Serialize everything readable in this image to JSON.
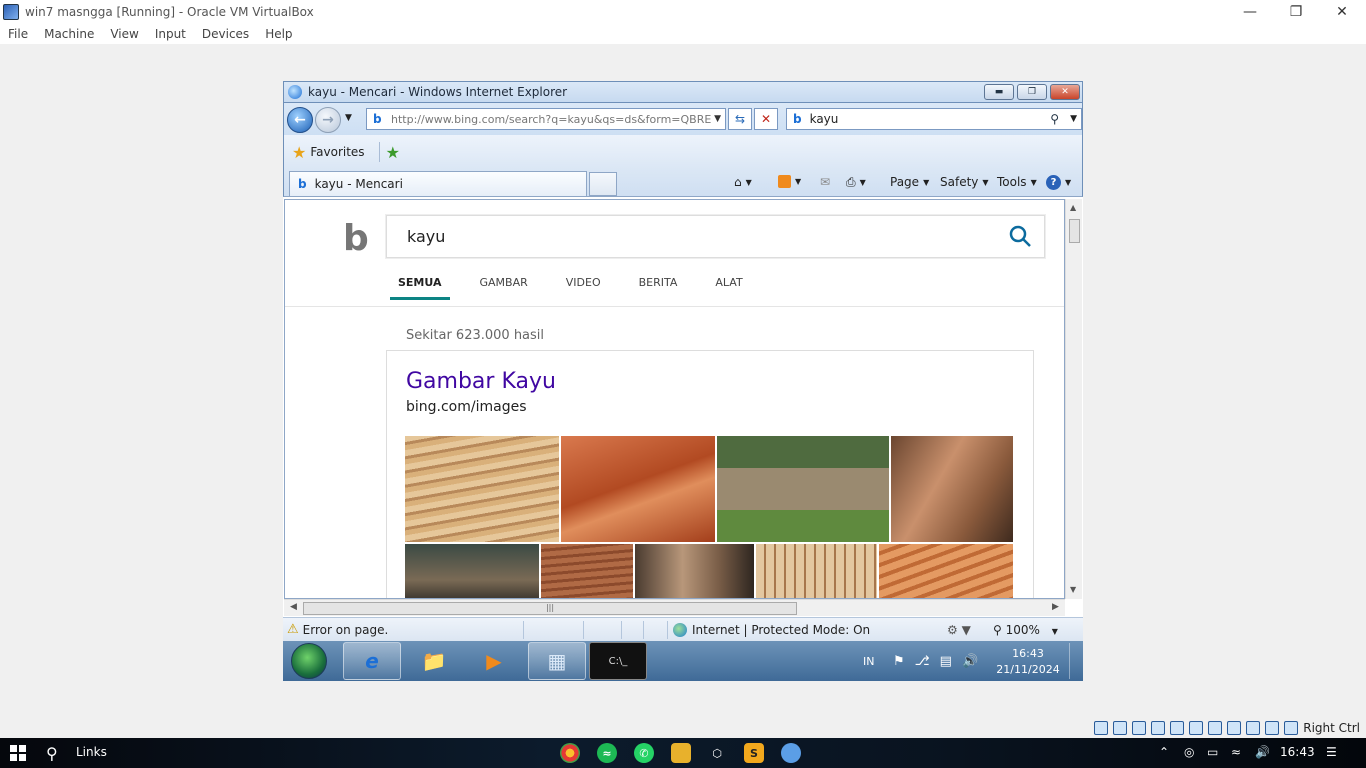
{
  "vbox": {
    "title": "win7 masngga [Running] - Oracle VM VirtualBox",
    "menu": [
      "File",
      "Machine",
      "View",
      "Input",
      "Devices",
      "Help"
    ],
    "host_key": "Right Ctrl"
  },
  "ie": {
    "title": "kayu - Mencari - Windows Internet Explorer",
    "address": "http://www.bing.com/search?q=kayu&qs=ds&form=QBRE",
    "search_box": "kayu",
    "favorites_label": "Favorites",
    "tab_label": "kayu - Mencari",
    "commands": [
      "Page",
      "Safety",
      "Tools"
    ],
    "status_text": "Error on page.",
    "zone_text": "Internet | Protected Mode: On",
    "zoom": "100%"
  },
  "bing": {
    "query": "kayu",
    "scopes": [
      "SEMUA",
      "GAMBAR",
      "VIDEO",
      "BERITA",
      "ALAT"
    ],
    "active_scope": "SEMUA",
    "result_count": "Sekitar 623.000 hasil",
    "card_title": "Gambar Kayu",
    "card_url": "bing.com/images"
  },
  "guest_taskbar": {
    "lang": "IN",
    "time": "16:43",
    "date": "21/11/2024"
  },
  "host_taskbar": {
    "search_label": "Links",
    "time": "16:43"
  },
  "colors": {
    "bing_link": "#4007a2",
    "bing_accent": "#0c8484",
    "ie_frame": "#c7daf0"
  }
}
